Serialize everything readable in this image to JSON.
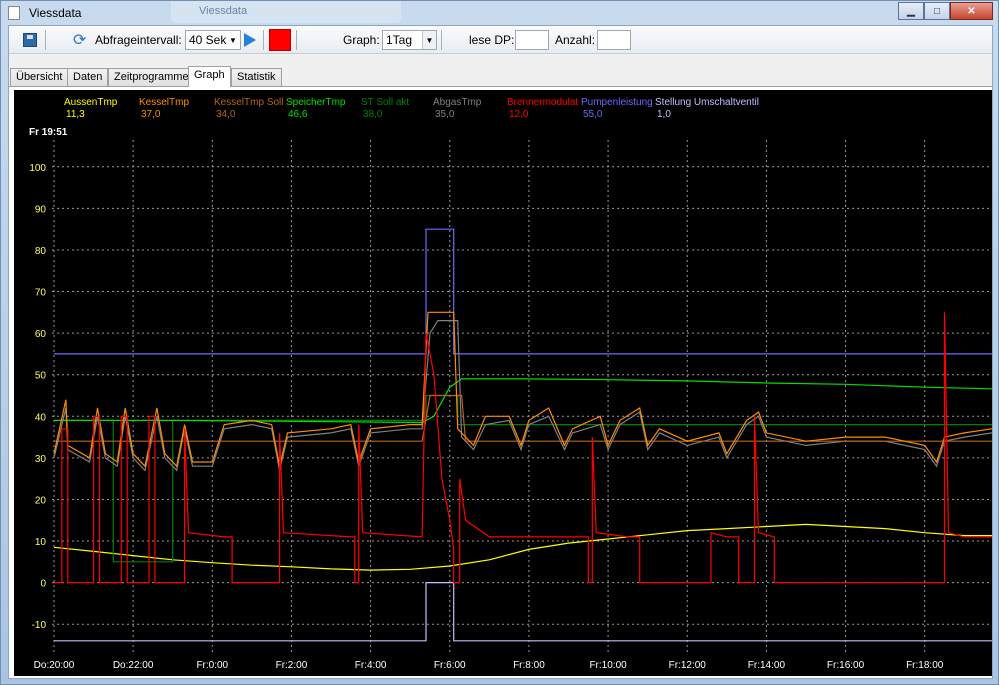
{
  "window": {
    "title": "Viessdata",
    "ghost_tab_title": "Viessdata",
    "buttons": {
      "minimize": "▁",
      "maximize": "□",
      "close": "✕"
    }
  },
  "toolbar": {
    "interval_label": "Abfrageintervall:",
    "interval_value": "40 Sek",
    "graph_label": "Graph:",
    "graph_value": "1Tag",
    "read_dp_label": "lese DP:",
    "read_dp_value": "",
    "count_label": "Anzahl:",
    "count_value": "",
    "status_color": "#ff0000"
  },
  "tabs": [
    {
      "label": "Übersicht",
      "active": false
    },
    {
      "label": "Daten",
      "active": false
    },
    {
      "label": "Zeitprogramme",
      "active": false
    },
    {
      "label": "Graph",
      "active": true
    },
    {
      "label": "Statistik",
      "active": false
    }
  ],
  "chart_data": {
    "type": "line",
    "cursor_label": "Fr 19:51",
    "ylim": [
      -15,
      105
    ],
    "yticks": [
      100,
      90,
      80,
      70,
      60,
      50,
      40,
      30,
      20,
      10,
      0,
      -10
    ],
    "x_tick_labels": [
      "Do:20:00",
      "Do:22:00",
      "Fr:0:00",
      "Fr:2:00",
      "Fr:4:00",
      "Fr:6:00",
      "Fr:8:00",
      "Fr:10:00",
      "Fr:12:00",
      "Fr:14:00",
      "Fr:16:00",
      "Fr:18:00"
    ],
    "x_hours": [
      0,
      2,
      4,
      6,
      8,
      10,
      12,
      14,
      16,
      18,
      20,
      22
    ],
    "xlim_hours": [
      -0.05,
      23.7
    ],
    "grid": true,
    "background": "#000000",
    "legend": [
      {
        "name": "AussenTmp",
        "value": "11,3",
        "color": "#ffff00"
      },
      {
        "name": "KesselTmp",
        "value": "37,0",
        "color": "#ff8c00"
      },
      {
        "name": "KesselTmp Soll",
        "value": "34,0",
        "color": "#b8641e"
      },
      {
        "name": "SpeicherTmp",
        "value": "46,6",
        "color": "#00e000"
      },
      {
        "name": "ST Soll akt",
        "value": "38,0",
        "color": "#008000"
      },
      {
        "name": "AbgasTmp",
        "value": "35,0",
        "color": "#808080"
      },
      {
        "name": "Brennermodulat",
        "value": "12,0",
        "color": "#ff0000"
      },
      {
        "name": "Pumpenleistung",
        "value": "55,0",
        "color": "#6a6aff"
      },
      {
        "name": "Stellung Umschaltventil",
        "value": "1,0",
        "color": "#c0c0ff"
      }
    ],
    "series": [
      {
        "name": "AussenTmp",
        "color": "#ffff00",
        "points": [
          [
            0,
            8.5
          ],
          [
            1,
            7.5
          ],
          [
            2,
            6.5
          ],
          [
            3,
            5.5
          ],
          [
            4,
            4.8
          ],
          [
            5,
            4.2
          ],
          [
            6,
            3.8
          ],
          [
            7,
            3.3
          ],
          [
            8,
            3.0
          ],
          [
            9,
            3.2
          ],
          [
            10,
            4.0
          ],
          [
            11,
            5.5
          ],
          [
            12,
            8.0
          ],
          [
            13,
            9.5
          ],
          [
            14,
            10.5
          ],
          [
            15,
            11.5
          ],
          [
            16,
            12.5
          ],
          [
            17,
            13.0
          ],
          [
            18,
            13.5
          ],
          [
            19,
            14.0
          ],
          [
            20,
            13.5
          ],
          [
            21,
            13.0
          ],
          [
            22,
            12.0
          ],
          [
            23,
            11.3
          ],
          [
            23.7,
            11.3
          ]
        ]
      },
      {
        "name": "ST Soll akt",
        "color": "#008000",
        "points": [
          [
            0,
            39
          ],
          [
            1.5,
            39
          ],
          [
            1.5,
            5
          ],
          [
            3,
            5
          ],
          [
            3,
            39
          ],
          [
            9.4,
            39
          ],
          [
            9.4,
            45
          ],
          [
            10.2,
            45
          ],
          [
            10.2,
            38
          ],
          [
            23.7,
            38
          ]
        ]
      },
      {
        "name": "SpeicherTmp",
        "color": "#00e000",
        "points": [
          [
            0,
            39
          ],
          [
            3,
            39
          ],
          [
            6,
            38.8
          ],
          [
            9.3,
            38.5
          ],
          [
            9.6,
            40
          ],
          [
            10,
            47
          ],
          [
            10.3,
            49
          ],
          [
            12,
            49
          ],
          [
            14,
            48.8
          ],
          [
            16,
            48.5
          ],
          [
            18,
            48
          ],
          [
            20,
            47.7
          ],
          [
            22,
            47
          ],
          [
            23.7,
            46.6
          ]
        ]
      },
      {
        "name": "Pumpenleistung",
        "color": "#6a6aff",
        "points": [
          [
            0,
            55
          ],
          [
            9.4,
            55
          ],
          [
            9.4,
            85
          ],
          [
            10.1,
            85
          ],
          [
            10.1,
            55
          ],
          [
            23.7,
            55
          ]
        ]
      },
      {
        "name": "Stellung Umschaltventil",
        "color": "#c0c0ff",
        "points": [
          [
            0,
            -14
          ],
          [
            9.4,
            -14
          ],
          [
            9.4,
            0
          ],
          [
            10.1,
            0
          ],
          [
            10.1,
            -14
          ],
          [
            23.7,
            -14
          ]
        ]
      },
      {
        "name": "AbgasTmp",
        "color": "#808080",
        "points": [
          [
            0,
            30
          ],
          [
            0.3,
            42
          ],
          [
            0.35,
            32
          ],
          [
            0.9,
            29
          ],
          [
            1.1,
            40
          ],
          [
            1.3,
            30
          ],
          [
            1.6,
            28
          ],
          [
            1.8,
            40
          ],
          [
            2.0,
            30
          ],
          [
            2.3,
            27
          ],
          [
            2.6,
            40
          ],
          [
            2.8,
            30
          ],
          [
            3.1,
            27
          ],
          [
            3.3,
            37
          ],
          [
            3.5,
            28
          ],
          [
            4,
            28
          ],
          [
            4.3,
            37
          ],
          [
            5.0,
            38
          ],
          [
            5.5,
            37
          ],
          [
            5.7,
            27
          ],
          [
            5.9,
            35
          ],
          [
            7,
            36
          ],
          [
            7.5,
            37
          ],
          [
            7.7,
            28
          ],
          [
            8,
            36
          ],
          [
            9,
            37
          ],
          [
            9.3,
            37
          ],
          [
            9.5,
            60
          ],
          [
            9.7,
            63
          ],
          [
            10.2,
            63
          ],
          [
            10.3,
            35
          ],
          [
            10.6,
            32
          ],
          [
            10.9,
            38
          ],
          [
            11.5,
            39
          ],
          [
            11.8,
            32
          ],
          [
            12,
            38
          ],
          [
            12.5,
            40
          ],
          [
            12.9,
            32
          ],
          [
            13.1,
            36
          ],
          [
            13.8,
            38
          ],
          [
            14,
            32
          ],
          [
            14.3,
            38
          ],
          [
            14.8,
            41
          ],
          [
            15,
            32
          ],
          [
            15.3,
            36
          ],
          [
            16,
            33
          ],
          [
            16.8,
            35
          ],
          [
            17,
            30
          ],
          [
            17.5,
            38
          ],
          [
            17.8,
            40
          ],
          [
            18,
            35
          ],
          [
            19,
            33
          ],
          [
            20,
            34
          ],
          [
            21,
            34
          ],
          [
            22,
            32
          ],
          [
            22.3,
            28
          ],
          [
            22.5,
            34
          ],
          [
            23,
            35
          ],
          [
            23.7,
            36
          ]
        ]
      },
      {
        "name": "KesselTmp Soll",
        "color": "#b8641e",
        "points": [
          [
            0,
            34
          ],
          [
            3,
            34
          ],
          [
            6,
            34
          ],
          [
            9.3,
            34
          ],
          [
            9.5,
            45
          ],
          [
            10.3,
            45
          ],
          [
            10.4,
            34
          ],
          [
            23.7,
            34
          ]
        ]
      },
      {
        "name": "KesselTmp",
        "color": "#ff8c00",
        "points": [
          [
            0,
            31
          ],
          [
            0.3,
            44
          ],
          [
            0.35,
            33
          ],
          [
            0.9,
            30
          ],
          [
            1.1,
            42
          ],
          [
            1.3,
            31
          ],
          [
            1.6,
            29
          ],
          [
            1.8,
            42
          ],
          [
            2.0,
            31
          ],
          [
            2.3,
            28
          ],
          [
            2.6,
            42
          ],
          [
            2.8,
            31
          ],
          [
            3.1,
            28
          ],
          [
            3.3,
            38
          ],
          [
            3.5,
            29
          ],
          [
            4,
            29
          ],
          [
            4.3,
            38
          ],
          [
            5.0,
            39
          ],
          [
            5.5,
            38
          ],
          [
            5.7,
            28
          ],
          [
            5.9,
            36
          ],
          [
            7,
            37
          ],
          [
            7.5,
            38
          ],
          [
            7.7,
            29
          ],
          [
            8,
            37
          ],
          [
            9,
            38
          ],
          [
            9.3,
            38
          ],
          [
            9.45,
            65
          ],
          [
            10.1,
            65
          ],
          [
            10.2,
            37
          ],
          [
            10.6,
            33
          ],
          [
            10.9,
            40
          ],
          [
            11.5,
            40
          ],
          [
            11.8,
            33
          ],
          [
            12,
            39
          ],
          [
            12.5,
            42
          ],
          [
            12.9,
            33
          ],
          [
            13.1,
            37
          ],
          [
            13.8,
            40
          ],
          [
            14,
            33
          ],
          [
            14.3,
            39
          ],
          [
            14.8,
            42
          ],
          [
            15,
            33
          ],
          [
            15.3,
            37
          ],
          [
            16,
            34
          ],
          [
            16.8,
            36
          ],
          [
            17,
            31
          ],
          [
            17.5,
            39
          ],
          [
            17.8,
            41
          ],
          [
            18,
            36
          ],
          [
            19,
            34
          ],
          [
            20,
            35
          ],
          [
            21,
            35
          ],
          [
            22,
            33
          ],
          [
            22.3,
            29
          ],
          [
            22.5,
            35
          ],
          [
            23,
            36
          ],
          [
            23.7,
            37
          ]
        ]
      },
      {
        "name": "Brennermodulat",
        "color": "#ff0000",
        "points": [
          [
            0,
            0
          ],
          [
            0.2,
            0
          ],
          [
            0.2,
            37
          ],
          [
            0.35,
            37
          ],
          [
            0.35,
            0
          ],
          [
            1,
            0
          ],
          [
            1,
            40
          ],
          [
            1.15,
            40
          ],
          [
            1.15,
            0
          ],
          [
            1.7,
            0
          ],
          [
            1.7,
            40
          ],
          [
            1.85,
            40
          ],
          [
            1.85,
            0
          ],
          [
            2.4,
            0
          ],
          [
            2.4,
            40
          ],
          [
            2.55,
            40
          ],
          [
            2.55,
            0
          ],
          [
            3.3,
            0
          ],
          [
            3.3,
            37
          ],
          [
            3.4,
            12
          ],
          [
            4.3,
            11
          ],
          [
            4.5,
            11
          ],
          [
            4.5,
            0
          ],
          [
            5.7,
            0
          ],
          [
            5.7,
            36
          ],
          [
            5.8,
            12
          ],
          [
            7.5,
            11
          ],
          [
            7.6,
            11
          ],
          [
            7.6,
            0
          ],
          [
            7.7,
            0
          ],
          [
            7.7,
            38
          ],
          [
            7.8,
            12
          ],
          [
            9.3,
            11
          ],
          [
            9.4,
            60
          ],
          [
            9.6,
            50
          ],
          [
            9.8,
            25
          ],
          [
            10.0,
            15
          ],
          [
            10.1,
            8
          ],
          [
            10.1,
            0
          ],
          [
            10.25,
            0
          ],
          [
            10.25,
            25
          ],
          [
            10.4,
            15
          ],
          [
            11,
            11
          ],
          [
            12,
            11
          ],
          [
            13,
            11
          ],
          [
            13.5,
            11
          ],
          [
            13.5,
            0
          ],
          [
            13.6,
            0
          ],
          [
            13.6,
            35
          ],
          [
            13.7,
            12
          ],
          [
            14.5,
            11
          ],
          [
            14.8,
            11
          ],
          [
            14.8,
            0
          ],
          [
            16.6,
            0
          ],
          [
            16.6,
            12
          ],
          [
            17,
            11
          ],
          [
            17.3,
            11
          ],
          [
            17.3,
            0
          ],
          [
            17.7,
            0
          ],
          [
            17.7,
            40
          ],
          [
            17.8,
            12
          ],
          [
            18.2,
            11
          ],
          [
            18.2,
            0
          ],
          [
            22.5,
            0
          ],
          [
            22.5,
            65
          ],
          [
            22.6,
            12
          ],
          [
            23,
            11
          ],
          [
            23.7,
            11
          ]
        ]
      }
    ]
  }
}
